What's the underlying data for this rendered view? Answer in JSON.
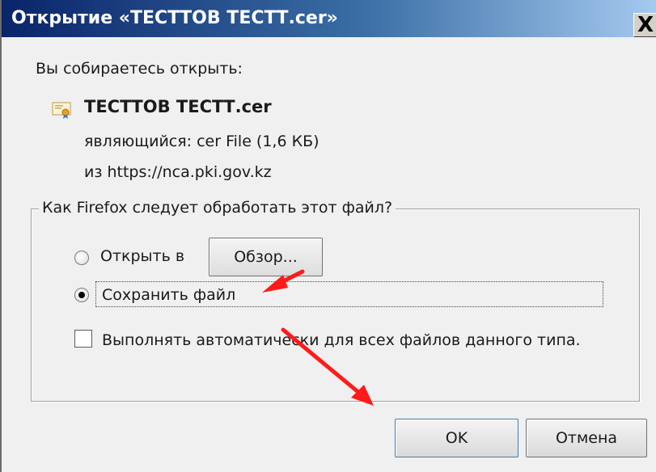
{
  "window": {
    "title": "Открытие «ТЕСТТОВ ТЕСТТ.cer»",
    "close_label": "X"
  },
  "dialog": {
    "prompt": "Вы собираетесь открыть:",
    "file_name": "ТЕСТТОВ ТЕСТТ.cer",
    "file_type": "являющийся:  cer File (1,6 КБ)",
    "file_from": "из  https://nca.pki.gov.kz",
    "file_icon": "certificate-icon"
  },
  "action_group": {
    "legend": "Как Firefox следует обработать этот файл?",
    "open_with": {
      "label": "Открыть в",
      "selected": false
    },
    "browse_button": "Обзор...",
    "save_file": {
      "label": "Сохранить файл",
      "selected": true
    },
    "auto_checkbox": {
      "label": "Выполнять автоматически для всех файлов данного типа.",
      "checked": false
    }
  },
  "buttons": {
    "ok": "OK",
    "cancel": "Отмена"
  },
  "annotations": {
    "arrow_color": "#ff1a1a"
  }
}
